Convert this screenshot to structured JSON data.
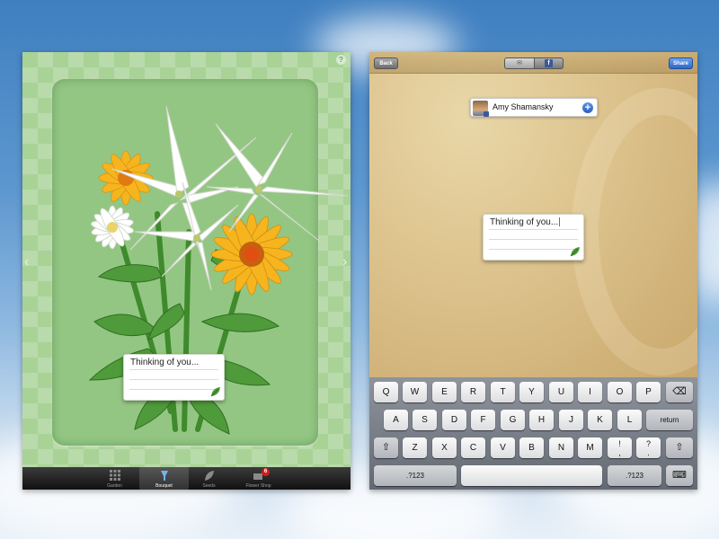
{
  "left": {
    "help_icon": "?",
    "note_text": "Thinking of you...",
    "tabs": [
      {
        "label": "Garden",
        "icon": "grid-icon"
      },
      {
        "label": "Bouquet",
        "icon": "bouquet-icon",
        "active": true
      },
      {
        "label": "Seeds",
        "icon": "seeds-icon"
      },
      {
        "label": "Flower Shop",
        "icon": "shop-icon",
        "badge": "6"
      }
    ]
  },
  "right": {
    "nav": {
      "back_label": "Back",
      "share_label": "Share",
      "mail_icon": "✉",
      "facebook_icon": "f"
    },
    "recipient": {
      "name": "Amy Shamansky",
      "add_icon": "+"
    },
    "note_text": "Thinking of you...",
    "keyboard": {
      "row1": [
        "Q",
        "W",
        "E",
        "R",
        "T",
        "Y",
        "U",
        "I",
        "O",
        "P",
        "⌫"
      ],
      "row2": [
        "A",
        "S",
        "D",
        "F",
        "G",
        "H",
        "J",
        "K",
        "L",
        "return"
      ],
      "row3": [
        "⇧",
        "Z",
        "X",
        "C",
        "V",
        "B",
        "N",
        "M",
        "!\n,",
        "?\n.",
        "⇧"
      ],
      "row4": [
        ".?123",
        "",
        ".?123",
        "⌨"
      ]
    }
  },
  "colors": {
    "green_bg": "#a9d297",
    "accent_blue": "#2d67c8",
    "paper": "#dcc28c"
  }
}
